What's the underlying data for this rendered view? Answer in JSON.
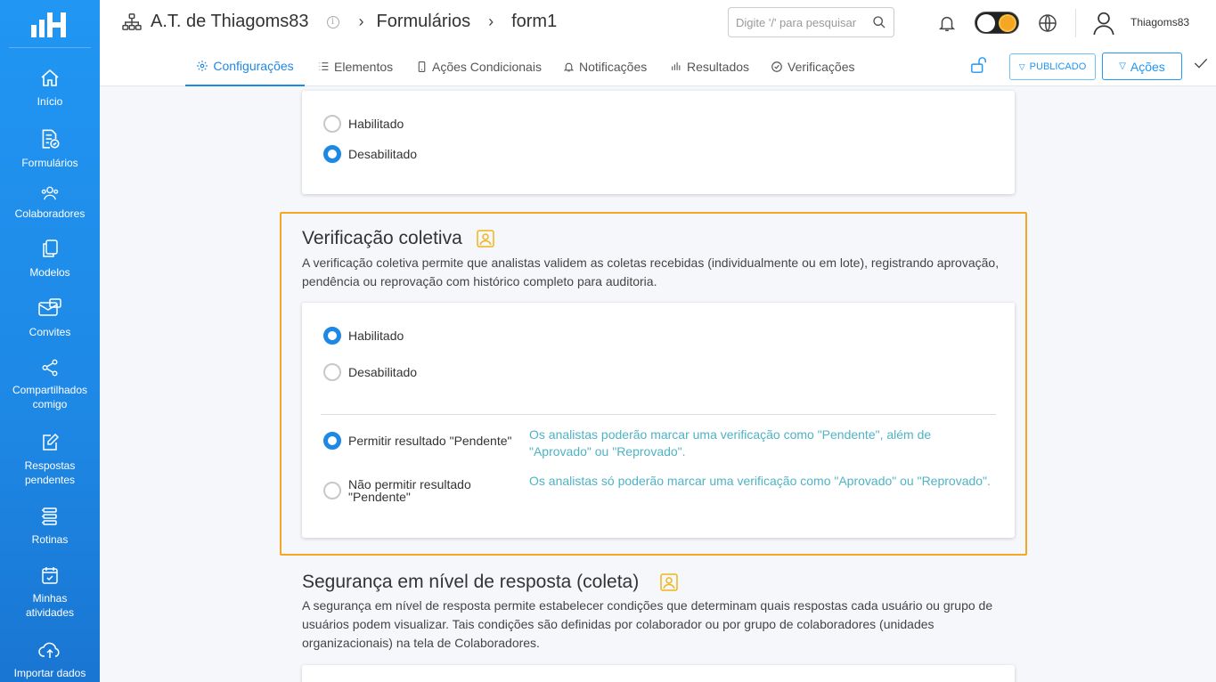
{
  "sidebar": {
    "items": [
      {
        "label": "Início",
        "icon": "home-icon"
      },
      {
        "label": "Formulários",
        "icon": "forms-icon"
      },
      {
        "label": "Colaboradores",
        "icon": "users-icon"
      },
      {
        "label": "Modelos",
        "icon": "copy-icon"
      },
      {
        "label": "Convites",
        "icon": "mail-icon"
      },
      {
        "label": "Compartilhados comigo",
        "icon": "share-icon"
      },
      {
        "label": "Respostas pendentes",
        "icon": "edit-icon"
      },
      {
        "label": "Rotinas",
        "icon": "list-icon"
      },
      {
        "label": "Minhas atividades",
        "icon": "calendar-check-icon"
      },
      {
        "label": "Importar dados",
        "icon": "cloud-upload-icon"
      }
    ]
  },
  "header": {
    "org": "A.T. de Thiagoms83",
    "crumb1": "Formulários",
    "crumb2": "form1",
    "search_placeholder": "Digite '/' para pesquisar",
    "username": "Thiagoms83"
  },
  "tabs": [
    {
      "label": "Configurações"
    },
    {
      "label": "Elementos"
    },
    {
      "label": "Ações Condicionais"
    },
    {
      "label": "Notificações"
    },
    {
      "label": "Resultados"
    },
    {
      "label": "Verificações"
    }
  ],
  "actions": {
    "published_label": "PUBLICADO",
    "actions_label": "Ações"
  },
  "top_card": {
    "opt1": "Habilitado",
    "opt2": "Desabilitado"
  },
  "collective": {
    "title": "Verificação coletiva",
    "desc1": "A verificação coletiva permite que analistas validem as coletas recebidas (individualmente ou em lote), registrando aprovação,",
    "desc2": "pendência ou reprovação com histórico completo para auditoria.",
    "opt1": "Habilitado",
    "opt2": "Desabilitado",
    "pending_allow": "Permitir resultado \"Pendente\"",
    "pending_allow_hint1": "Os analistas poderão marcar uma verificação como \"Pendente\", além de",
    "pending_allow_hint2": "\"Aprovado\" ou \"Reprovado\".",
    "pending_deny1": "Não permitir resultado",
    "pending_deny2": "\"Pendente\"",
    "pending_deny_hint": "Os analistas só poderão marcar uma verificação como \"Aprovado\" ou \"Reprovado\"."
  },
  "security": {
    "title": "Segurança em nível de resposta (coleta)",
    "desc1": "A segurança em nível de resposta permite estabelecer condições que determinam quais respostas cada usuário ou grupo de",
    "desc2": "usuários podem visualizar. Tais condições são definidas por colaborador ou por grupo de colaboradores (unidades",
    "desc3": "organizacionais) na tela de Colaboradores."
  },
  "colors": {
    "primary": "#1e88e5",
    "highlight_border": "#f5a623",
    "hint": "#4fb3c4",
    "premium_icon": "#f2b418"
  }
}
